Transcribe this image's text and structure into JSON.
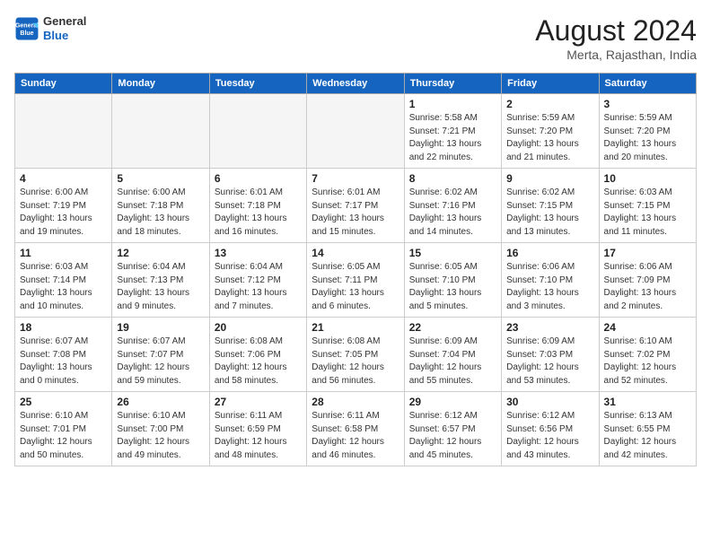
{
  "header": {
    "logo_general": "General",
    "logo_blue": "Blue",
    "month_year": "August 2024",
    "location": "Merta, Rajasthan, India"
  },
  "days_of_week": [
    "Sunday",
    "Monday",
    "Tuesday",
    "Wednesday",
    "Thursday",
    "Friday",
    "Saturday"
  ],
  "weeks": [
    [
      {
        "day": "",
        "empty": true
      },
      {
        "day": "",
        "empty": true
      },
      {
        "day": "",
        "empty": true
      },
      {
        "day": "",
        "empty": true
      },
      {
        "day": "1",
        "sunrise": "5:58 AM",
        "sunset": "7:21 PM",
        "daylight": "13 hours and 22 minutes."
      },
      {
        "day": "2",
        "sunrise": "5:59 AM",
        "sunset": "7:20 PM",
        "daylight": "13 hours and 21 minutes."
      },
      {
        "day": "3",
        "sunrise": "5:59 AM",
        "sunset": "7:20 PM",
        "daylight": "13 hours and 20 minutes."
      }
    ],
    [
      {
        "day": "4",
        "sunrise": "6:00 AM",
        "sunset": "7:19 PM",
        "daylight": "13 hours and 19 minutes."
      },
      {
        "day": "5",
        "sunrise": "6:00 AM",
        "sunset": "7:18 PM",
        "daylight": "13 hours and 18 minutes."
      },
      {
        "day": "6",
        "sunrise": "6:01 AM",
        "sunset": "7:18 PM",
        "daylight": "13 hours and 16 minutes."
      },
      {
        "day": "7",
        "sunrise": "6:01 AM",
        "sunset": "7:17 PM",
        "daylight": "13 hours and 15 minutes."
      },
      {
        "day": "8",
        "sunrise": "6:02 AM",
        "sunset": "7:16 PM",
        "daylight": "13 hours and 14 minutes."
      },
      {
        "day": "9",
        "sunrise": "6:02 AM",
        "sunset": "7:15 PM",
        "daylight": "13 hours and 13 minutes."
      },
      {
        "day": "10",
        "sunrise": "6:03 AM",
        "sunset": "7:15 PM",
        "daylight": "13 hours and 11 minutes."
      }
    ],
    [
      {
        "day": "11",
        "sunrise": "6:03 AM",
        "sunset": "7:14 PM",
        "daylight": "13 hours and 10 minutes."
      },
      {
        "day": "12",
        "sunrise": "6:04 AM",
        "sunset": "7:13 PM",
        "daylight": "13 hours and 9 minutes."
      },
      {
        "day": "13",
        "sunrise": "6:04 AM",
        "sunset": "7:12 PM",
        "daylight": "13 hours and 7 minutes."
      },
      {
        "day": "14",
        "sunrise": "6:05 AM",
        "sunset": "7:11 PM",
        "daylight": "13 hours and 6 minutes."
      },
      {
        "day": "15",
        "sunrise": "6:05 AM",
        "sunset": "7:10 PM",
        "daylight": "13 hours and 5 minutes."
      },
      {
        "day": "16",
        "sunrise": "6:06 AM",
        "sunset": "7:10 PM",
        "daylight": "13 hours and 3 minutes."
      },
      {
        "day": "17",
        "sunrise": "6:06 AM",
        "sunset": "7:09 PM",
        "daylight": "13 hours and 2 minutes."
      }
    ],
    [
      {
        "day": "18",
        "sunrise": "6:07 AM",
        "sunset": "7:08 PM",
        "daylight": "13 hours and 0 minutes."
      },
      {
        "day": "19",
        "sunrise": "6:07 AM",
        "sunset": "7:07 PM",
        "daylight": "12 hours and 59 minutes."
      },
      {
        "day": "20",
        "sunrise": "6:08 AM",
        "sunset": "7:06 PM",
        "daylight": "12 hours and 58 minutes."
      },
      {
        "day": "21",
        "sunrise": "6:08 AM",
        "sunset": "7:05 PM",
        "daylight": "12 hours and 56 minutes."
      },
      {
        "day": "22",
        "sunrise": "6:09 AM",
        "sunset": "7:04 PM",
        "daylight": "12 hours and 55 minutes."
      },
      {
        "day": "23",
        "sunrise": "6:09 AM",
        "sunset": "7:03 PM",
        "daylight": "12 hours and 53 minutes."
      },
      {
        "day": "24",
        "sunrise": "6:10 AM",
        "sunset": "7:02 PM",
        "daylight": "12 hours and 52 minutes."
      }
    ],
    [
      {
        "day": "25",
        "sunrise": "6:10 AM",
        "sunset": "7:01 PM",
        "daylight": "12 hours and 50 minutes."
      },
      {
        "day": "26",
        "sunrise": "6:10 AM",
        "sunset": "7:00 PM",
        "daylight": "12 hours and 49 minutes."
      },
      {
        "day": "27",
        "sunrise": "6:11 AM",
        "sunset": "6:59 PM",
        "daylight": "12 hours and 48 minutes."
      },
      {
        "day": "28",
        "sunrise": "6:11 AM",
        "sunset": "6:58 PM",
        "daylight": "12 hours and 46 minutes."
      },
      {
        "day": "29",
        "sunrise": "6:12 AM",
        "sunset": "6:57 PM",
        "daylight": "12 hours and 45 minutes."
      },
      {
        "day": "30",
        "sunrise": "6:12 AM",
        "sunset": "6:56 PM",
        "daylight": "12 hours and 43 minutes."
      },
      {
        "day": "31",
        "sunrise": "6:13 AM",
        "sunset": "6:55 PM",
        "daylight": "12 hours and 42 minutes."
      }
    ]
  ]
}
